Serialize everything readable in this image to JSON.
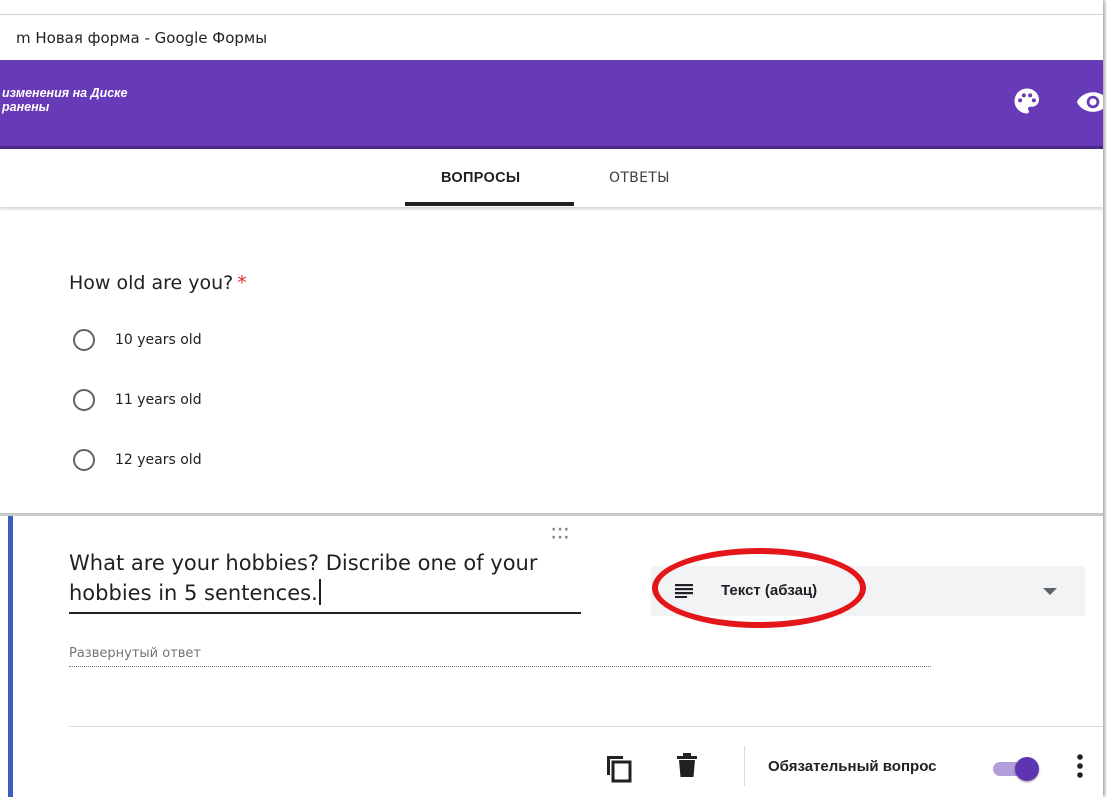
{
  "window": {
    "title": "m  Новая форма - Google Формы"
  },
  "header": {
    "saved_line1": "изменения на Диске",
    "saved_line2": "ранены",
    "color": "#673ab7"
  },
  "tabs": [
    {
      "label": "ВОПРОСЫ",
      "active": true
    },
    {
      "label": "ОТВЕТЫ",
      "active": false
    }
  ],
  "question1": {
    "title": "How old are you?",
    "required_mark": "*",
    "options": [
      "10 years old",
      "11 years old",
      "12 years old"
    ]
  },
  "question2": {
    "title": "What are your hobbies? Discribe one of your hobbies in 5 sentences.",
    "type_label": "Текст (абзац)",
    "answer_placeholder": "Развернутый ответ"
  },
  "footer": {
    "required_label": "Обязательный вопрос",
    "required_on": true
  },
  "icons": [
    "palette-icon",
    "eye-icon",
    "short-text-icon",
    "chevron-down-icon",
    "copy-icon",
    "trash-icon",
    "more-vert-icon",
    "drag-handle-icon"
  ],
  "colors": {
    "accent": "#673ab7",
    "highlight": "#e3161a",
    "required": "#d93025"
  }
}
